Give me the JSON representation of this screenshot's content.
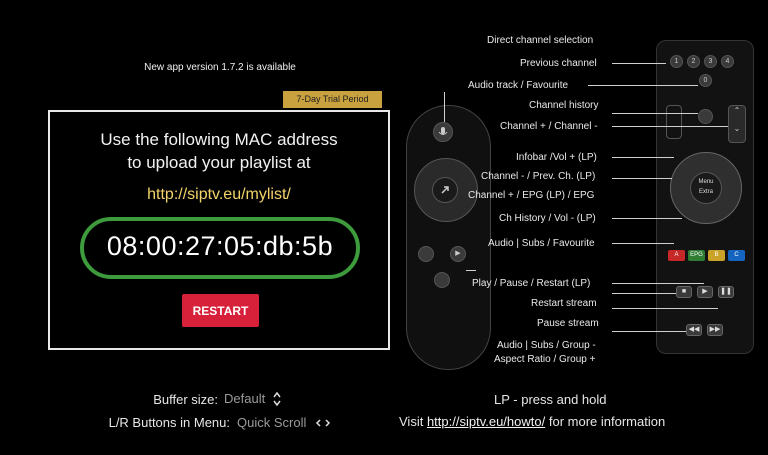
{
  "update_notice": "New app version 1.7.2 is available",
  "trial_badge": "7-Day Trial Period",
  "instruction_line1": "Use the following MAC address",
  "instruction_line2": "to upload your playlist at",
  "playlist_url": "http://siptv.eu/mylist/",
  "mac_address": "08:00:27:05:db:5b",
  "restart_label": "RESTART",
  "settings": {
    "buffer_label": "Buffer size:",
    "buffer_value": "Default",
    "lr_label": "L/R Buttons in Menu:",
    "lr_value": "Quick Scroll"
  },
  "remote_labels": {
    "direct_channel": "Direct channel selection",
    "previous_channel": "Previous channel",
    "audio_track": "Audio track / Favourite",
    "channel_history": "Channel history",
    "channel_plus_minus": "Channel + / Channel -",
    "infobar": "Infobar /Vol + (LP)",
    "channel_minus_prev": "Channel - / Prev. Ch. (LP)",
    "channel_plus_epg": "Channel + / EPG (LP) / EPG",
    "ch_history_vol": "Ch History / Vol - (LP)",
    "audio_subs_fav": "Audio | Subs / Favourite",
    "play_pause": "Play / Pause / Restart (LP)",
    "restart_stream": "Restart stream",
    "pause_stream": "Pause stream",
    "audio_subs_group": "Audio | Subs / Group -",
    "aspect_ratio": "Aspect Ratio / Group +"
  },
  "remote_buttons": {
    "num1": "1",
    "num2": "2",
    "num3": "3",
    "num4": "4",
    "num0": "0",
    "menu": "Menu",
    "extra": "Extra",
    "red_btn": "A",
    "green_btn": "EPG",
    "yellow_btn": "B",
    "blue_btn": "C"
  },
  "lp_note": "LP - press and hold",
  "footer": {
    "visit": "Visit",
    "link": "http://siptv.eu/howto/",
    "suffix": "for more information"
  },
  "colors": {
    "accent_green": "#3d9a3d",
    "restart_red": "#d7203a",
    "trial_gold": "#c9a23f",
    "url_yellow": "#f2d46a"
  }
}
